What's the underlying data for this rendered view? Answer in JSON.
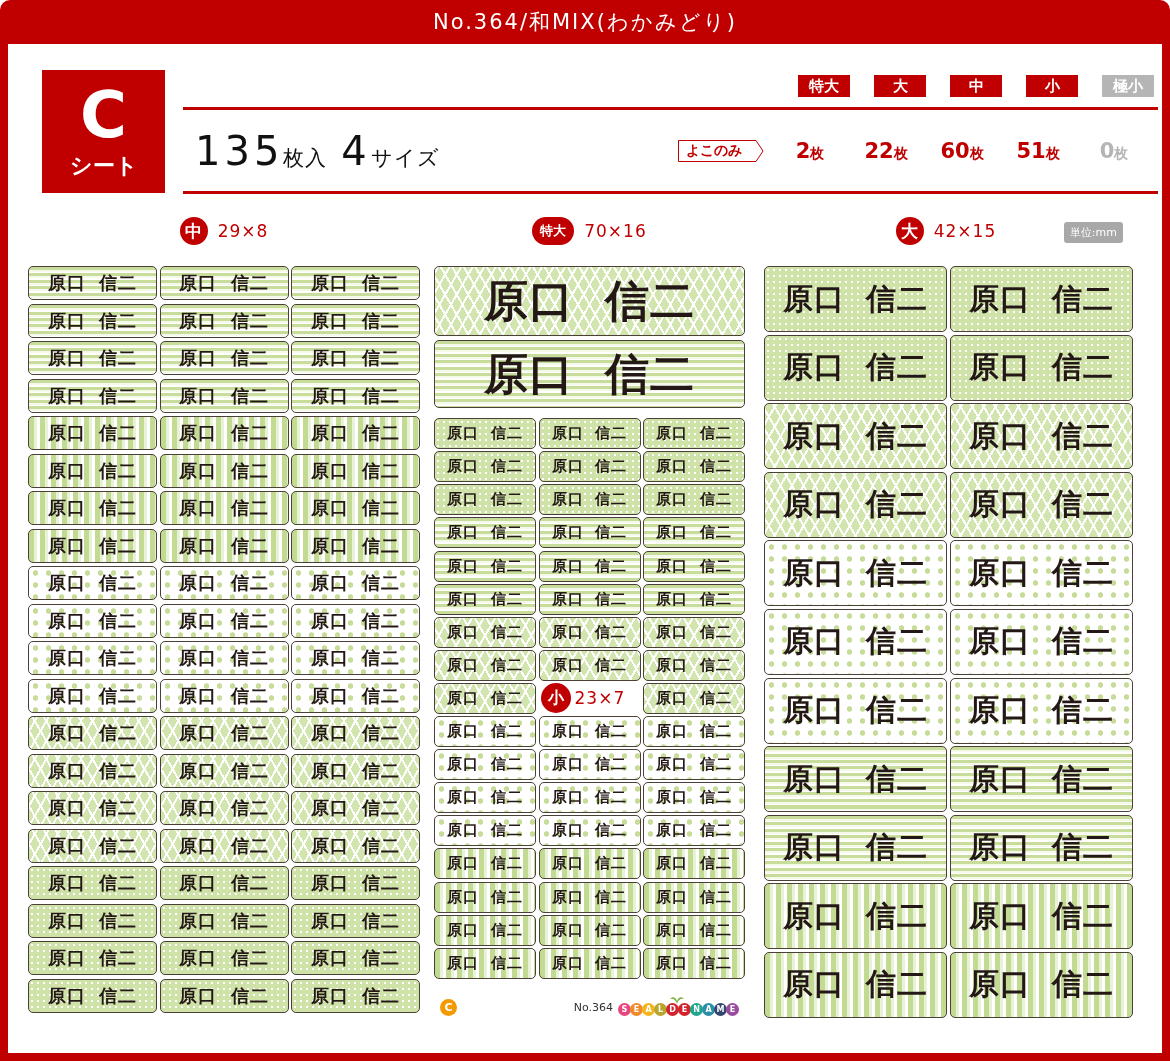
{
  "title": "No.364/和MIX(わかみどり)",
  "sheet": {
    "letter": "C",
    "label": "シート",
    "total": "135",
    "total_unit": "枚入",
    "size_count": "4",
    "size_unit": "サイズ",
    "note": "よこのみ"
  },
  "sizes": [
    {
      "label": "特大",
      "count": "2",
      "unit": "枚",
      "available": true
    },
    {
      "label": "大",
      "count": "22",
      "unit": "枚",
      "available": true
    },
    {
      "label": "中",
      "count": "60",
      "unit": "枚",
      "available": true
    },
    {
      "label": "小",
      "count": "51",
      "unit": "枚",
      "available": true
    },
    {
      "label": "極小",
      "count": "0",
      "unit": "枚",
      "available": false
    }
  ],
  "unit_note": "単位:mm",
  "left": {
    "badge": "中",
    "size": "29×8",
    "groups": [
      {
        "kind": "stripes",
        "rows": [
          [
            "原口 信二",
            "原口 信二",
            "原口 信二"
          ],
          [
            "原口 信二",
            "原口 信二",
            "原口 信二"
          ],
          [
            "原口 信二",
            "原口 信二",
            "原口 信二"
          ],
          [
            "原口 信二",
            "原口 信二",
            "原口 信二"
          ]
        ]
      },
      {
        "kind": "arrows",
        "rows": [
          [
            "原口 信二",
            "原口 信二",
            "原口 信二"
          ],
          [
            "原口 信二",
            "原口 信二",
            "原口 信二"
          ],
          [
            "原口 信二",
            "原口 信二",
            "原口 信二"
          ],
          [
            "原口 信二",
            "原口 信二",
            "原口 信二"
          ]
        ]
      },
      {
        "kind": "bigdots",
        "rows": [
          [
            "原口 信二",
            "原口 信二",
            "原口 信二"
          ],
          [
            "原口 信二",
            "原口 信二",
            "原口 信二"
          ],
          [
            "原口 信二",
            "原口 信二",
            "原口 信二"
          ],
          [
            "原口 信二",
            "原口 信二",
            "原口 信二"
          ]
        ]
      },
      {
        "kind": "triangles",
        "rows": [
          [
            "原口 信二",
            "原口 信二",
            "原口 信二"
          ],
          [
            "原口 信二",
            "原口 信二",
            "原口 信二"
          ],
          [
            "原口 信二",
            "原口 信二",
            "原口 信二"
          ],
          [
            "原口 信二",
            "原口 信二",
            "原口 信二"
          ]
        ]
      },
      {
        "kind": "finedots",
        "rows": [
          [
            "原口 信二",
            "原口 信二",
            "原口 信二"
          ],
          [
            "原口 信二",
            "原口 信二",
            "原口 信二"
          ],
          [
            "原口 信二",
            "原口 信二",
            "原口 信二"
          ],
          [
            "原口 信二",
            "原口 信二",
            "原口 信二"
          ]
        ]
      }
    ]
  },
  "middle": {
    "badge": "特大",
    "size": "70×16",
    "big": [
      {
        "kind": "triangles",
        "text": "原口 信二"
      },
      {
        "kind": "stripes",
        "text": "原口 信二"
      }
    ],
    "groups": [
      {
        "kind": "finedots",
        "rows": [
          [
            "原口 信二",
            "原口 信二",
            "原口 信二"
          ],
          [
            "原口 信二",
            "原口 信二",
            "原口 信二"
          ],
          [
            "原口 信二",
            "原口 信二",
            "原口 信二"
          ]
        ]
      },
      {
        "kind": "stripes",
        "rows": [
          [
            "原口 信二",
            "原口 信二",
            "原口 信二"
          ],
          [
            "原口 信二",
            "原口 信二",
            "原口 信二"
          ],
          [
            "原口 信二",
            "原口 信二",
            "原口 信二"
          ]
        ]
      },
      {
        "kind": "triangles",
        "rows": [
          [
            "原口 信二",
            "原口 信二",
            "原口 信二"
          ],
          [
            "原口 信二",
            "原口 信二",
            "原口 信二"
          ],
          [
            "原口 信二",
            {
              "kind": "size_label",
              "badge": "小",
              "size": "23×7"
            },
            "原口 信二"
          ]
        ]
      },
      {
        "kind": "bigdots",
        "rows": [
          [
            "原口 信二",
            "原口 信二",
            "原口 信二"
          ],
          [
            "原口 信二",
            "原口 信二",
            "原口 信二"
          ],
          [
            "原口 信二",
            "原口 信二",
            "原口 信二"
          ],
          [
            "原口 信二",
            "原口 信二",
            "原口 信二"
          ]
        ]
      },
      {
        "kind": "arrows",
        "rows": [
          [
            "原口 信二",
            "原口 信二",
            "原口 信二"
          ],
          [
            "原口 信二",
            "原口 信二",
            "原口 信二"
          ],
          [
            "原口 信二",
            "原口 信二",
            "原口 信二"
          ],
          [
            "原口 信二",
            "原口 信二",
            "原口 信二"
          ]
        ]
      }
    ],
    "footer": {
      "mark": "C",
      "number": "No.364",
      "logo": [
        {
          "letter": "S",
          "color": "#e8457e"
        },
        {
          "letter": "E",
          "color": "#f08a2a"
        },
        {
          "letter": "A",
          "color": "#f3b51c"
        },
        {
          "letter": "L",
          "color": "#b8a62c"
        },
        {
          "letter": "D",
          "color": "#d3232c"
        },
        {
          "letter": "E",
          "color": "#d3232c"
        },
        {
          "letter": "N",
          "color": "#21a68e"
        },
        {
          "letter": "A",
          "color": "#2b8fa8"
        },
        {
          "letter": "M",
          "color": "#34466e"
        },
        {
          "letter": "E",
          "color": "#9a4b9f"
        }
      ]
    }
  },
  "right": {
    "badge": "大",
    "size": "42×15",
    "groups": [
      {
        "kind": "finedots",
        "rows": [
          [
            "原口 信二",
            "原口 信二"
          ],
          [
            "原口 信二",
            "原口 信二"
          ]
        ]
      },
      {
        "kind": "triangles",
        "rows": [
          [
            "原口 信二",
            "原口 信二"
          ],
          [
            "原口 信二",
            "原口 信二"
          ]
        ]
      },
      {
        "kind": "bigdots",
        "rows": [
          [
            "原口 信二",
            "原口 信二"
          ],
          [
            "原口 信二",
            "原口 信二"
          ],
          [
            "原口 信二",
            "原口 信二"
          ]
        ]
      },
      {
        "kind": "stripes",
        "rows": [
          [
            "原口 信二",
            "原口 信二"
          ],
          [
            "原口 信二",
            "原口 信二"
          ]
        ]
      },
      {
        "kind": "arrows",
        "rows": [
          [
            "原口 信二",
            "原口 信二"
          ],
          [
            "原口 信二",
            "原口 信二"
          ]
        ]
      }
    ]
  }
}
